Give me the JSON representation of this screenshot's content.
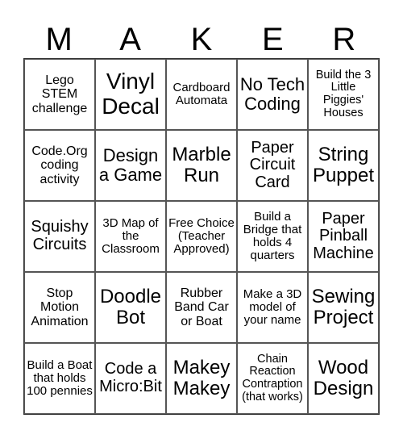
{
  "header": {
    "letters": [
      "M",
      "A",
      "K",
      "E",
      "R"
    ]
  },
  "cells": [
    "Lego STEM challenge",
    "Vinyl Decal",
    "Cardboard Automata",
    "No Tech Coding",
    "Build the 3 Little Piggies' Houses",
    "Code.Org coding activity",
    "Design a Game",
    "Marble Run",
    "Paper Circuit Card",
    "String Puppet",
    "Squishy Circuits",
    "3D Map of the Classroom",
    "Free Choice (Teacher Approved)",
    "Build a Bridge that holds 4 quarters",
    "Paper Pinball Machine",
    "Stop Motion Animation",
    "Doodle Bot",
    "Rubber Band Car or Boat",
    "Make a 3D model of your name",
    "Sewing Project",
    "Build a Boat that holds 100 pennies",
    "Code a Micro:Bit",
    "Makey Makey",
    "Chain Reaction Contraption (that works)",
    "Wood Design"
  ]
}
